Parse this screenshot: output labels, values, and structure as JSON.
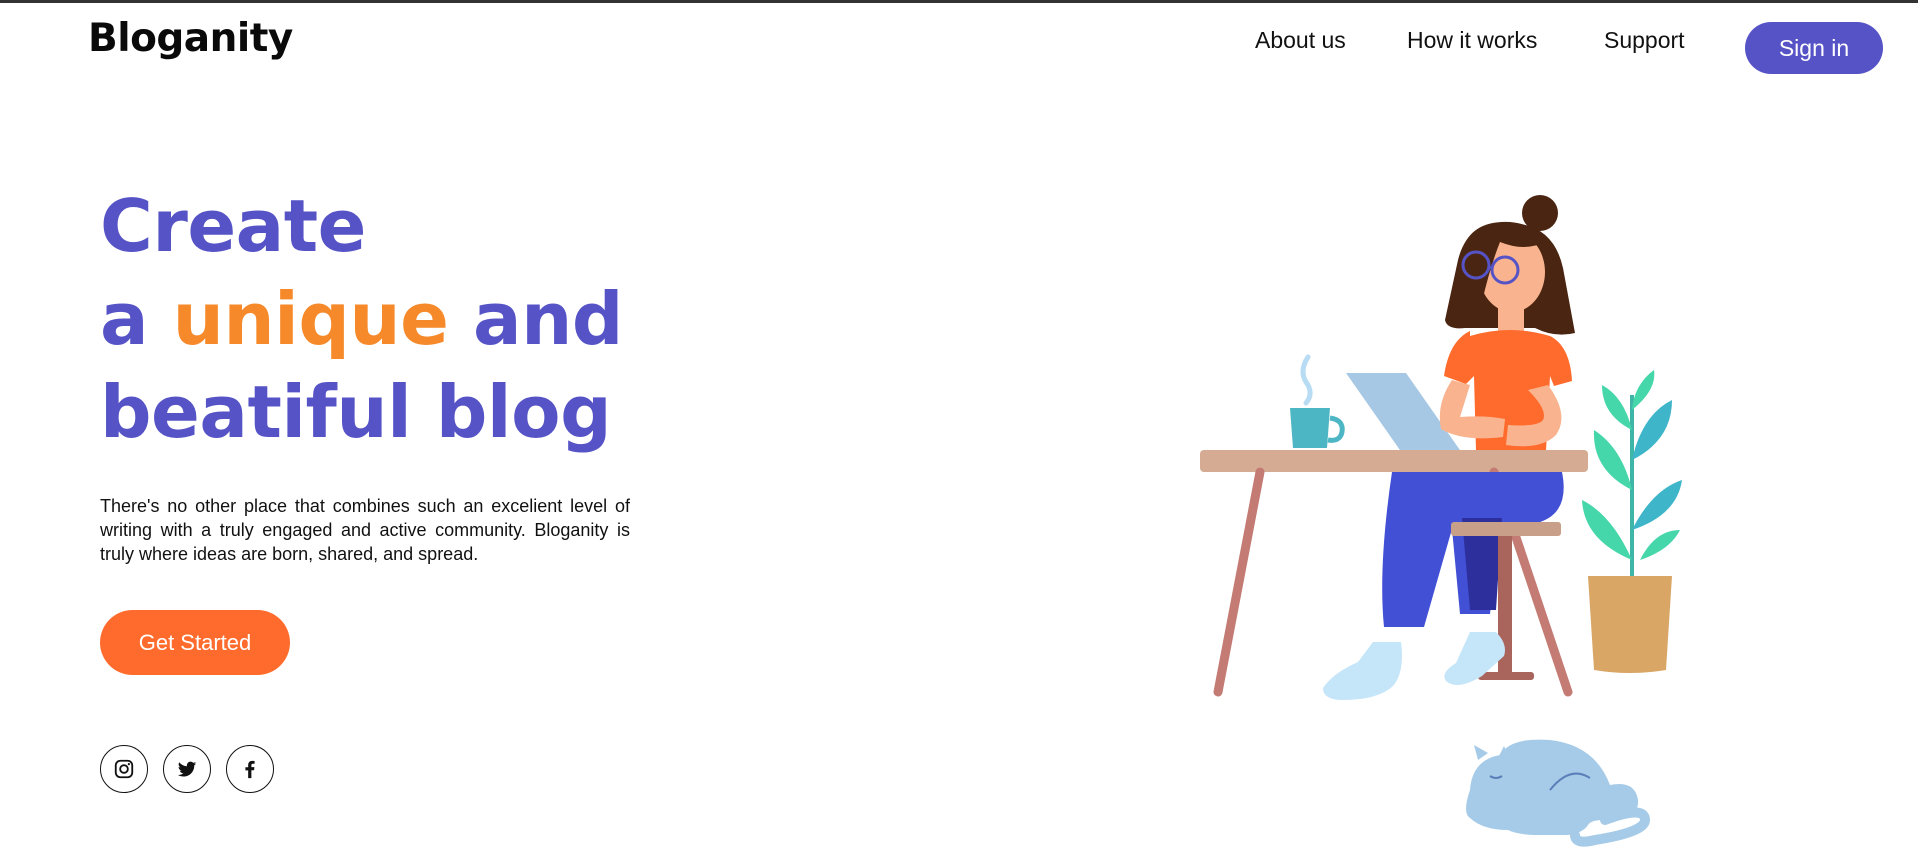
{
  "brand": {
    "name": "Bloganity"
  },
  "nav": {
    "items": [
      "About us",
      "How it works",
      "Support"
    ],
    "signin_label": "Sign in"
  },
  "hero": {
    "headline": {
      "line1": "Create",
      "line2_pre": "a ",
      "line2_highlight": "unique",
      "line2_post": " and",
      "line3": "beatiful blog"
    },
    "description": "There's no other place that combines such an excelient level of writing with a truly engaged and active community. Bloganity is truly where ideas are born, shared, and spread.",
    "cta_label": "Get Started"
  },
  "social": [
    "instagram-icon",
    "twitter-icon",
    "facebook-icon"
  ],
  "colors": {
    "accent": "#5653c7",
    "highlight": "#f68a2b",
    "cta": "#ff6b2c"
  },
  "illustration": {
    "subject": "woman-working-at-desk",
    "includes": [
      "coffee-mug",
      "laptop",
      "plant",
      "sleeping-cat"
    ]
  }
}
